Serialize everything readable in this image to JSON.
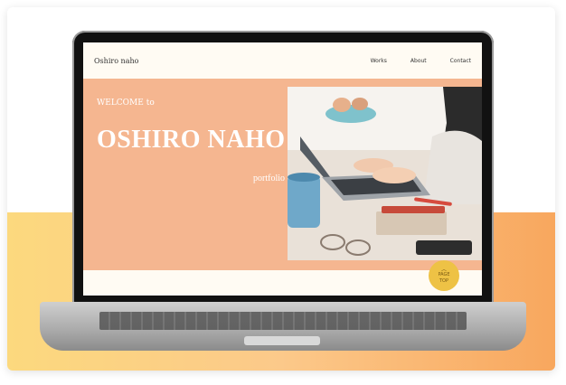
{
  "site": {
    "logo": "Oshiro naho",
    "nav": [
      {
        "label": "Works"
      },
      {
        "label": "About"
      },
      {
        "label": "Contact"
      }
    ]
  },
  "hero": {
    "welcome": "WELCOME to",
    "title": "OSHIRO NAHO",
    "subtitle": "portfolio",
    "background_color": "#f5b690"
  },
  "page_top": {
    "line1": "PAGE",
    "line2": "TOP",
    "icon": "chevron-up-icon"
  },
  "colors": {
    "accent_yellow": "#eec245",
    "gradient_left": "#fcd97e",
    "gradient_right": "#f8a75e"
  }
}
